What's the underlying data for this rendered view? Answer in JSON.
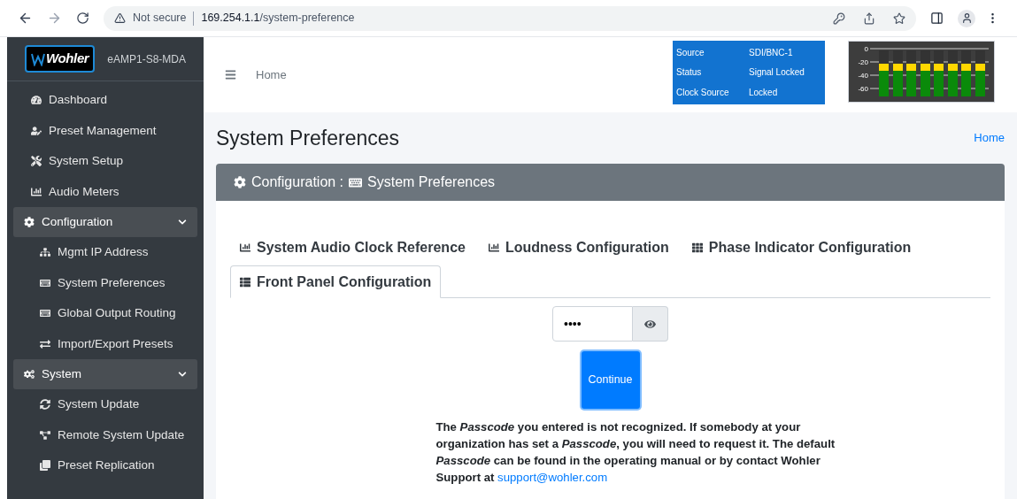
{
  "browser": {
    "security": "Not secure",
    "url_host": "169.254.1.1",
    "url_path": "/system-preference"
  },
  "sidebar": {
    "device": "eAMP1-S8-MDA",
    "logo": "Wohler",
    "items": [
      {
        "label": "Dashboard"
      },
      {
        "label": "Preset Management"
      },
      {
        "label": "System Setup"
      },
      {
        "label": "Audio Meters"
      },
      {
        "label": "Configuration",
        "expanded": true,
        "children": [
          {
            "label": "Mgmt IP Address"
          },
          {
            "label": "System Preferences"
          },
          {
            "label": "Global Output Routing"
          },
          {
            "label": "Import/Export Presets"
          }
        ]
      },
      {
        "label": "System",
        "expanded": true,
        "children": [
          {
            "label": "System Update"
          },
          {
            "label": "Remote System Update"
          },
          {
            "label": "Preset Replication"
          }
        ]
      }
    ]
  },
  "header": {
    "breadcrumb": "Home",
    "status": [
      {
        "label": "Source",
        "value": "SDI/BNC-1"
      },
      {
        "label": "Status",
        "value": "Signal Locked"
      },
      {
        "label": "Clock Source",
        "value": "Locked"
      }
    ],
    "meter": {
      "scale": [
        "0",
        "-20",
        "-40",
        "-60"
      ],
      "channels": [
        {
          "level": 0.72
        },
        {
          "level": 0.72
        },
        {
          "level": 0.72
        },
        {
          "level": 0.72
        },
        {
          "level": 0.72
        },
        {
          "level": 0.72
        },
        {
          "level": 0.72
        },
        {
          "level": 0.72
        }
      ]
    }
  },
  "page": {
    "title": "System Preferences",
    "breadcrumb": "Home",
    "panel_title": "Configuration : ",
    "panel_subtitle": "System Preferences",
    "tabs": [
      {
        "label": "System Audio Clock Reference",
        "selected": false
      },
      {
        "label": "Loudness Configuration",
        "selected": false
      },
      {
        "label": "Phase Indicator Configuration",
        "selected": false
      },
      {
        "label": "Front Panel Configuration",
        "selected": true
      }
    ],
    "passcode": {
      "value": "••••"
    },
    "continue": "Continue",
    "message": "The *Passcode* you entered is not recognized. If somebody at your organization has set a *Passcode*, you will need to request it. The default *Passcode* can be found in the operating manual or by contact Wohler Support at",
    "link": "support@wohler.com"
  }
}
